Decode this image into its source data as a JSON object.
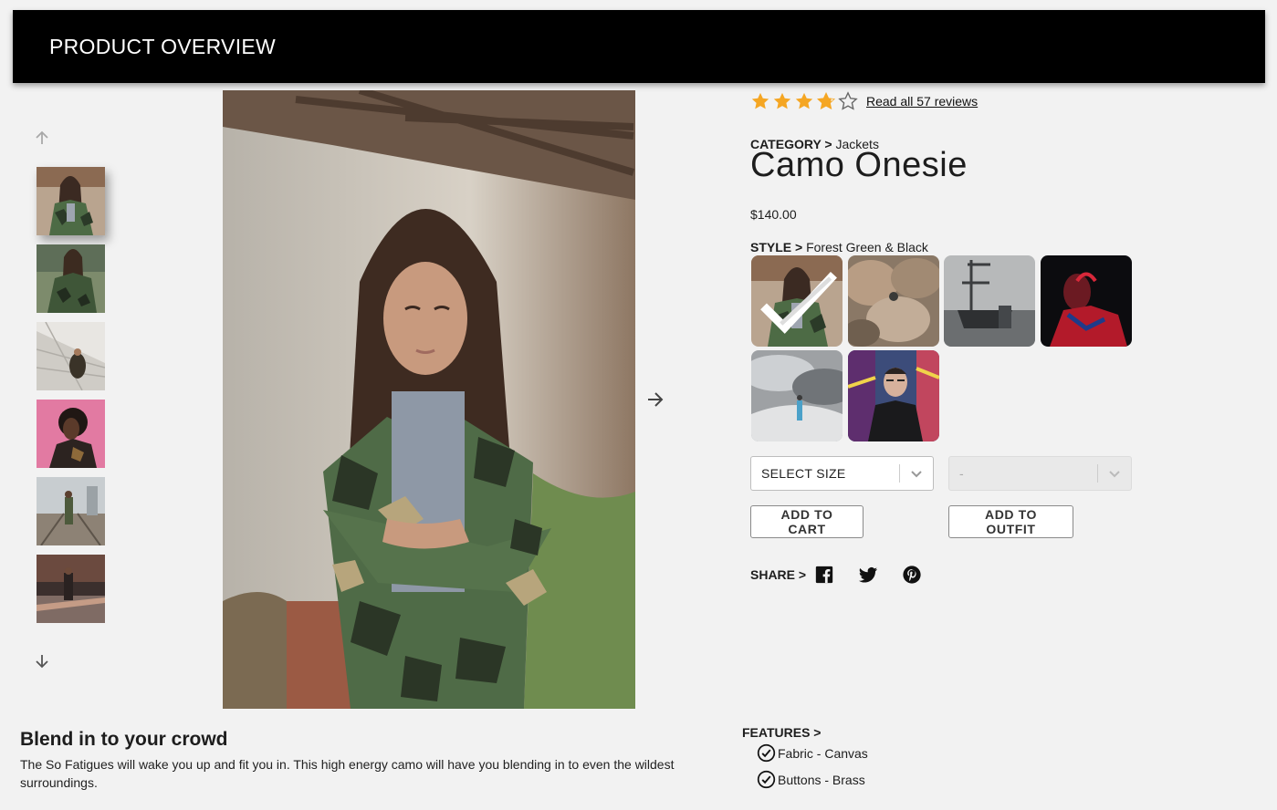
{
  "header": {
    "title": "PRODUCT OVERVIEW"
  },
  "rating": {
    "value": 3.8,
    "max": 5,
    "reviews_link": "Read all 57 reviews"
  },
  "product": {
    "category_label": "CATEGORY >",
    "category": "Jackets",
    "name": "Camo Onesie",
    "price": "$140.00"
  },
  "style": {
    "label": "STYLE >",
    "selected": "Forest Green & Black",
    "swatches": [
      "camo-jacket-woman",
      "rocks",
      "harbor-boats",
      "red-lit-man",
      "snow-figure",
      "graffiti-man"
    ]
  },
  "gallery": {
    "thumbnails": [
      "camo-jacket-woman",
      "camo-sitting",
      "architecture-figure",
      "pink-background-woman",
      "railway-figure",
      "sunset-figure"
    ]
  },
  "size_select": {
    "placeholder": "SELECT SIZE"
  },
  "quantity_select": {
    "placeholder": "-"
  },
  "actions": {
    "add_to_cart": "ADD TO CART",
    "add_to_outfit": "ADD TO OUTFIT"
  },
  "share": {
    "label": "SHARE >",
    "icons": [
      "facebook-icon",
      "twitter-icon",
      "pinterest-icon"
    ]
  },
  "description": {
    "slogan": "Blend in to your crowd",
    "text": "The So Fatigues will wake you up and fit you in. This high energy camo will have you blending in to even the wildest surroundings."
  },
  "features": {
    "label": "FEATURES >",
    "items": [
      "Fabric - Canvas",
      "Buttons - Brass"
    ]
  },
  "colors": {
    "star": "#f5a623",
    "header_bg": "#000000",
    "page_bg": "#f2f2f2"
  }
}
